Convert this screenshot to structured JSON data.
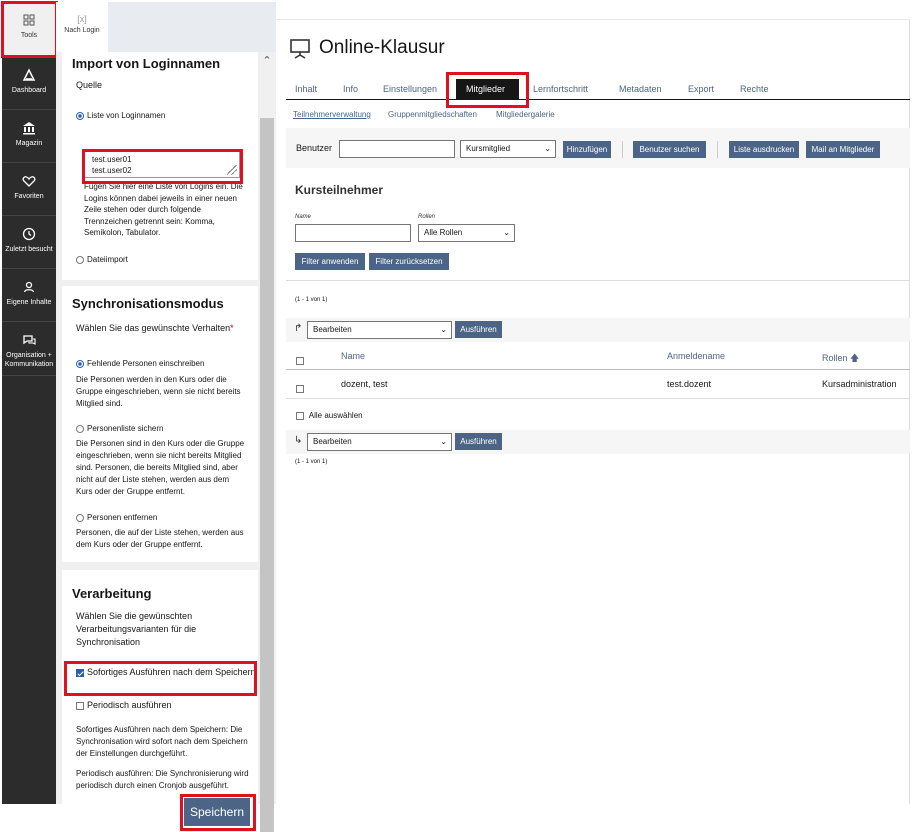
{
  "mainbar": {
    "items": [
      {
        "label": "Tools",
        "icon": "tools-icon"
      },
      {
        "label": "Dashboard",
        "icon": "dashboard-icon"
      },
      {
        "label": "Magazin",
        "icon": "magazine-icon"
      },
      {
        "label": "Favoriten",
        "icon": "heart-icon"
      },
      {
        "label": "Zuletzt besucht",
        "icon": "clock-icon"
      },
      {
        "label": "Eigene Inhalte",
        "icon": "user-icon"
      },
      {
        "label": "Organisation + Kommunikation",
        "icon": "chat-icon"
      }
    ]
  },
  "slate": {
    "nav_label": "Nach Login",
    "import": {
      "title": "Import von Loginnamen",
      "source_label": "Quelle",
      "option_list": "Liste von Loginnamen",
      "textarea_lines": [
        "test.user01",
        "test.user02"
      ],
      "help": "Fügen Sie hier eine Liste von Logins ein. Die Logins können dabei jeweils in einer neuen Zeile stehen oder durch folgende Trennzeichen getrennt sein: Komma, Semikolon, Tabulator.",
      "option_file": "Dateiimport"
    },
    "sync": {
      "title": "Synchronisationsmodus",
      "prompt": "Wählen Sie das gewünschte Verhalten",
      "required": "*",
      "opt1": "Fehlende Personen einschreiben",
      "opt1_help": "Die Personen werden in den Kurs oder die Gruppe eingeschrieben, wenn sie nicht bereits Mitglied sind.",
      "opt2": "Personenliste sichern",
      "opt2_help": "Die Personen sind in den Kurs oder die Gruppe eingeschrieben, wenn sie nicht bereits Mitglied sind. Personen, die bereits Mitglied sind, aber nicht auf der Liste stehen, werden aus dem Kurs oder der Gruppe entfernt.",
      "opt3": "Personen entfernen",
      "opt3_help": "Personen, die auf der Liste stehen, werden aus dem Kurs oder der Gruppe entfernt."
    },
    "processing": {
      "title": "Verarbeitung",
      "prompt": "Wählen Sie die gewünschten Verarbeitungsvarianten für die Synchronisation",
      "chk1": "Sofortiges Ausführen nach dem Speichern",
      "chk2": "Periodisch ausführen",
      "help1": "Sofortiges Ausführen nach dem Speichern: Die Synchronisation wird sofort nach dem Speichern der Einstellungen durchgeführt.",
      "help2": "Periodisch ausführen: Die Synchronisierung wird periodisch durch einen Cronjob ausgeführt."
    },
    "save_label": "Speichern"
  },
  "content": {
    "title": "Online-Klausur",
    "tabs": [
      "Inhalt",
      "Info",
      "Einstellungen",
      "Mitglieder",
      "Lernfortschritt",
      "Metadaten",
      "Export",
      "Rechte"
    ],
    "subtabs": [
      "Teilnehmerverwaltung",
      "Gruppenmitgliedschaften",
      "Mitgliedergalerie"
    ],
    "toolbar": {
      "user_label": "Benutzer",
      "role_select": "Kursmitglied",
      "add": "Hinzufügen",
      "search": "Benutzer suchen",
      "print": "Liste ausdrucken",
      "mail": "Mail an Mitglieder"
    },
    "participants": {
      "title": "Kursteilnehmer",
      "filter_name_label": "Name",
      "filter_roles_label": "Rollen",
      "filter_roles_value": "Alle Rollen",
      "apply": "Filter anwenden",
      "reset": "Filter zurücksetzen",
      "count_top": "(1 - 1 von 1)",
      "count_bottom": "(1 - 1 von 1)",
      "action_select": "Bearbeiten",
      "execute": "Ausführen",
      "columns": [
        "Name",
        "Anmeldename",
        "Rollen"
      ],
      "rows": [
        {
          "name": "dozent, test",
          "login": "test.dozent",
          "role": "Kursadministration"
        }
      ],
      "select_all": "Alle auswählen"
    }
  }
}
